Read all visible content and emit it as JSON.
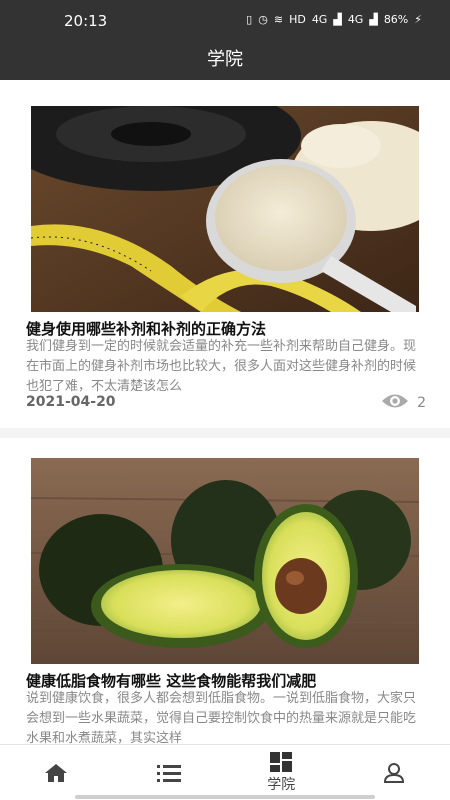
{
  "status_bar": {
    "time": "20:13",
    "network": "HD",
    "signal1": "4G",
    "signal2": "4G",
    "battery": "86%"
  },
  "header": {
    "title": "学院"
  },
  "articles": [
    {
      "title": "健身使用哪些补剂和补剂的正确方法",
      "description": "我们健身到一定的时候就会适量的补充一些补剂来帮助自己健身。现在市面上的健身补剂市场也比较大，很多人面对这些健身补剂的时候也犯了难，不太清楚该怎么",
      "date": "2021-04-20",
      "views": "2",
      "image": "protein-powder-scoop-image"
    },
    {
      "title": "健康低脂食物有哪些 这些食物能帮我们减肥",
      "description": "说到健康饮食，很多人都会想到低脂食物。一说到低脂食物，大家只会想到一些水果蔬菜，觉得自己要控制饮食中的热量来源就是只能吃水果和水煮蔬菜，其实这样",
      "image": "avocado-image"
    }
  ],
  "tab_bar": {
    "tabs": [
      {
        "label": "",
        "icon": "home-icon"
      },
      {
        "label": "",
        "icon": "list-icon"
      },
      {
        "label": "学院",
        "icon": "grid-icon",
        "active": true
      },
      {
        "label": "",
        "icon": "user-icon"
      }
    ]
  }
}
